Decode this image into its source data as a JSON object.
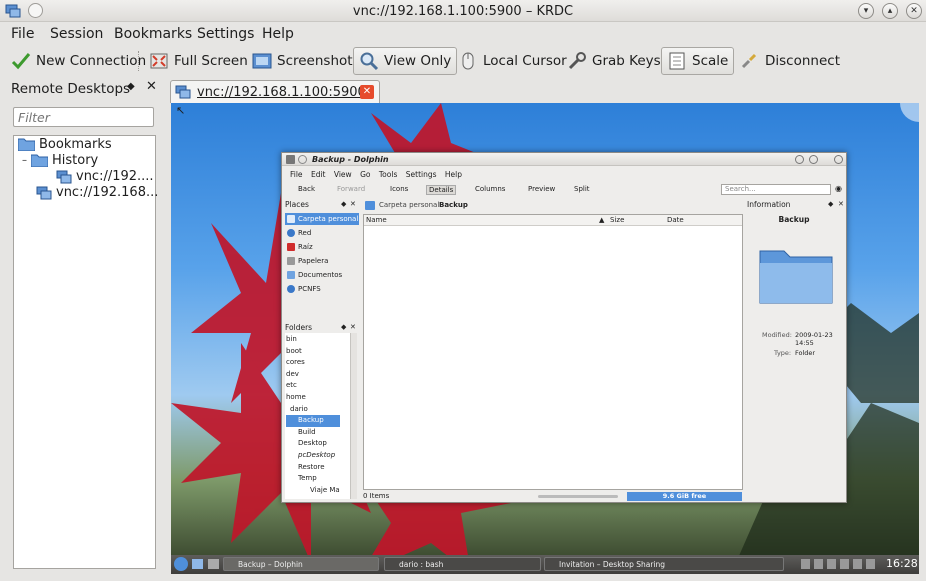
{
  "window": {
    "title": "vnc://192.168.1.100:5900 – KRDC"
  },
  "menu": {
    "items": [
      "File",
      "Session",
      "Bookmarks",
      "Settings",
      "Help"
    ]
  },
  "toolbar": {
    "new_connection": "New Connection",
    "full_screen": "Full Screen",
    "screenshot": "Screenshot",
    "view_only": "View Only",
    "local_cursor": "Local Cursor",
    "grab_keys": "Grab Keys",
    "scale": "Scale",
    "disconnect": "Disconnect"
  },
  "sidebar": {
    "title": "Remote Desktops",
    "filter_placeholder": "Filter",
    "tree": {
      "bookmarks": "Bookmarks",
      "history": "History",
      "history_item": "vnc://192....",
      "item": "vnc://192.168..."
    }
  },
  "tabs": [
    {
      "label": "vnc://192.168.1.100:5900"
    }
  ],
  "remote": {
    "dolphin": {
      "title": "Backup - Dolphin",
      "menu": [
        "File",
        "Edit",
        "View",
        "Go",
        "Tools",
        "Settings",
        "Help"
      ],
      "toolbar": [
        "Back",
        "Forward",
        "Icons",
        "Details",
        "Columns",
        "Preview",
        "Split"
      ],
      "search_placeholder": "Search...",
      "breadcrumb": [
        "Carpeta personal",
        "Backup"
      ],
      "places_title": "Places",
      "places": [
        "Carpeta personal",
        "Red",
        "Raíz",
        "Papelera",
        "Documentos",
        "PCNFS"
      ],
      "folders_title": "Folders",
      "folders": [
        "bin",
        "boot",
        "cores",
        "dev",
        "etc",
        "home",
        "dario",
        "Backup",
        "Build",
        "Desktop",
        "pcDesktop",
        "Restore",
        "Temp",
        "Viaje Ma"
      ],
      "columns": {
        "name": "Name",
        "size": "Size",
        "date": "Date"
      },
      "status": "0 Items",
      "free_space": "9.6 GiB free",
      "info": {
        "title": "Information",
        "name": "Backup",
        "modified_label": "Modified:",
        "modified_value": "2009-01-23 14:55",
        "type_label": "Type:",
        "type_value": "Folder"
      }
    },
    "taskbar": {
      "tasks": [
        "Backup – Dolphin",
        "dario : bash",
        "Invitation – Desktop Sharing"
      ],
      "clock": "16:28"
    }
  },
  "colors": {
    "accent": "#4f8fdb",
    "tab_close": "#e64b2c",
    "leaf": "#c0162a"
  }
}
